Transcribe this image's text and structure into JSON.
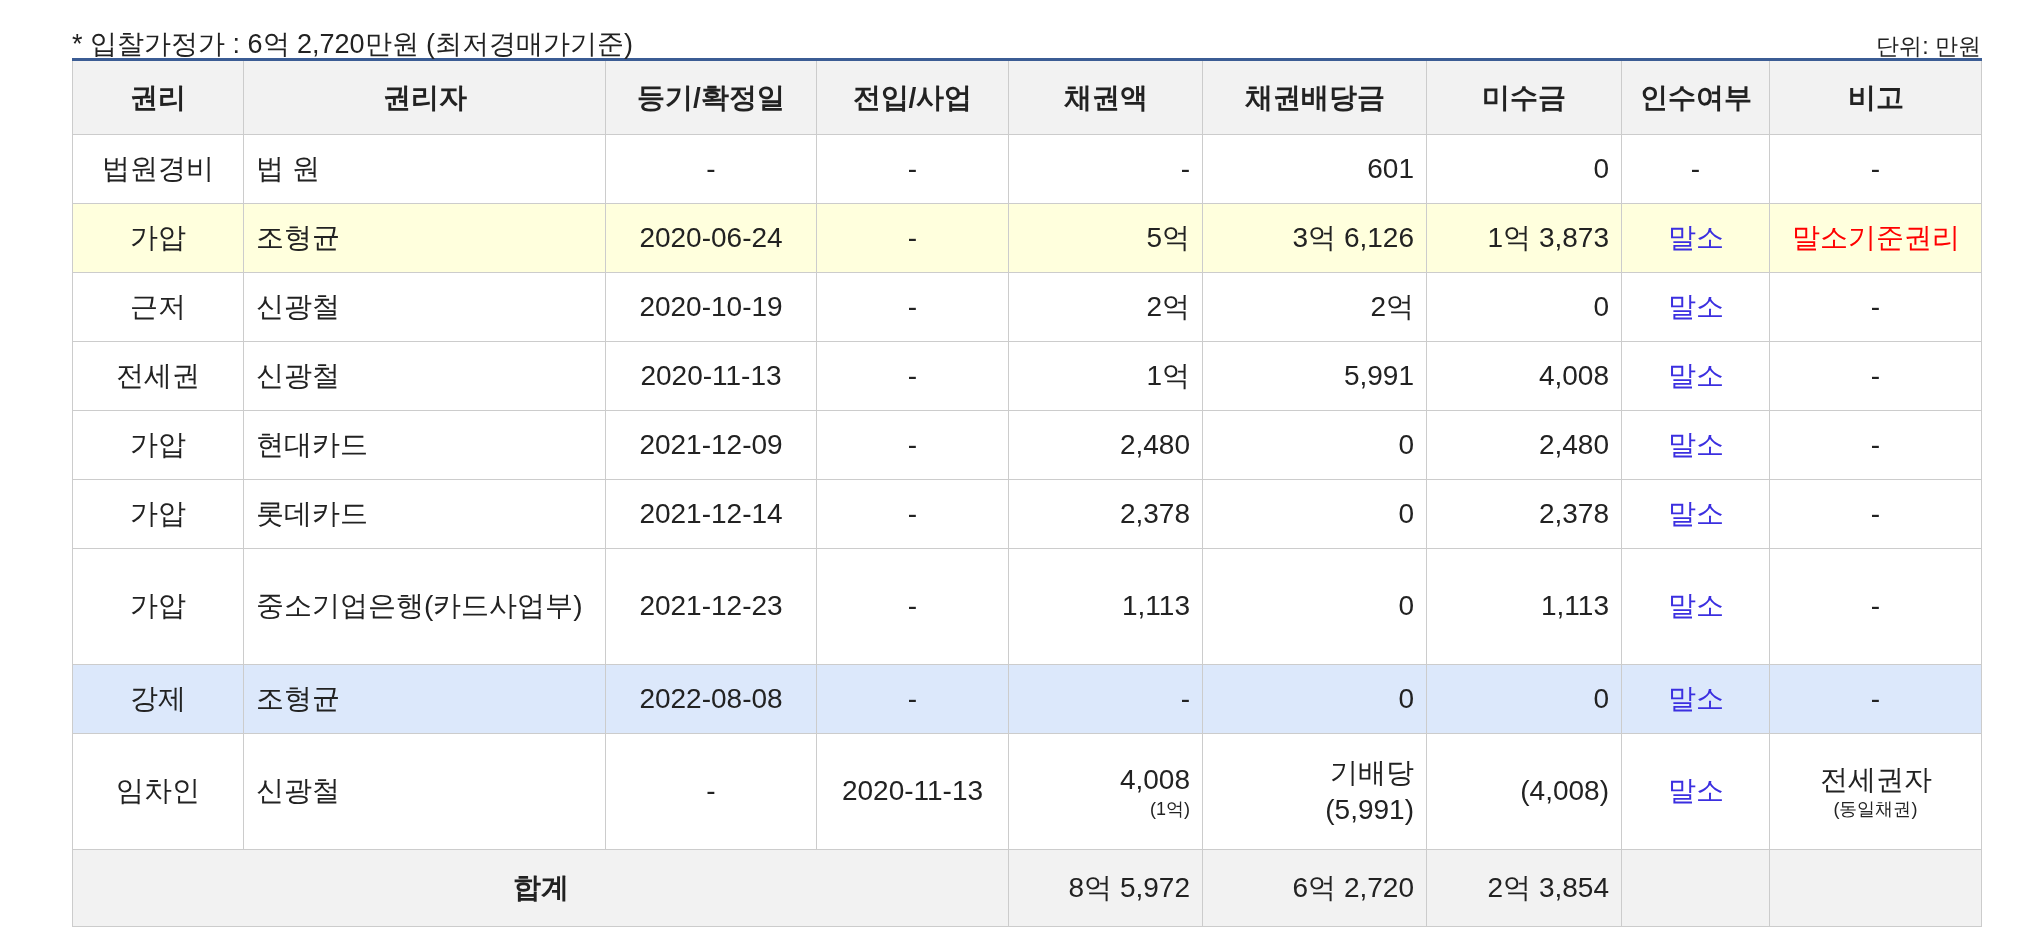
{
  "caption": "* 입찰가정가 : 6억 2,720만원 (최저경매가기준)",
  "unit": "단위: 만원",
  "columns": [
    "권리",
    "권리자",
    "등기/확정일",
    "전입/사업",
    "채권액",
    "채권배당금",
    "미수금",
    "인수여부",
    "비고"
  ],
  "rows": [
    {
      "color": "#ffffff",
      "right": "법원경비",
      "holder": "법 원",
      "date": "-",
      "move_in": "-",
      "claim": "-",
      "dividend": "601",
      "unpaid": "0",
      "assumption": "-",
      "assumption_link": false,
      "remark": "-",
      "remark_alert": false
    },
    {
      "color": "#ffffdd",
      "right": "가압",
      "holder": "조형균",
      "date": "2020-06-24",
      "move_in": "-",
      "claim": "5억",
      "dividend": "3억 6,126",
      "unpaid": "1억 3,873",
      "assumption": "말소",
      "assumption_link": true,
      "remark": "말소기준권리",
      "remark_alert": true
    },
    {
      "color": "#ffffff",
      "right": "근저",
      "holder": "신광철",
      "date": "2020-10-19",
      "move_in": "-",
      "claim": "2억",
      "dividend": "2억",
      "unpaid": "0",
      "assumption": "말소",
      "assumption_link": true,
      "remark": "-",
      "remark_alert": false
    },
    {
      "color": "#ffffff",
      "right": "전세권",
      "holder": "신광철",
      "date": "2020-11-13",
      "move_in": "-",
      "claim": "1억",
      "dividend": "5,991",
      "unpaid": "4,008",
      "assumption": "말소",
      "assumption_link": true,
      "remark": "-",
      "remark_alert": false
    },
    {
      "color": "#ffffff",
      "right": "가압",
      "holder": "현대카드",
      "date": "2021-12-09",
      "move_in": "-",
      "claim": "2,480",
      "dividend": "0",
      "unpaid": "2,480",
      "assumption": "말소",
      "assumption_link": true,
      "remark": "-",
      "remark_alert": false
    },
    {
      "color": "#ffffff",
      "right": "가압",
      "holder": "롯데카드",
      "date": "2021-12-14",
      "move_in": "-",
      "claim": "2,378",
      "dividend": "0",
      "unpaid": "2,378",
      "assumption": "말소",
      "assumption_link": true,
      "remark": "-",
      "remark_alert": false
    },
    {
      "color": "#ffffff",
      "right": "가압",
      "holder": "중소기업은행(카드사업부)",
      "date": "2021-12-23",
      "move_in": "-",
      "claim": "1,113",
      "dividend": "0",
      "unpaid": "1,113",
      "assumption": "말소",
      "assumption_link": true,
      "remark": "-",
      "remark_alert": false
    },
    {
      "color": "#dce8fb",
      "right": "강제",
      "holder": "조형균",
      "date": "2022-08-08",
      "move_in": "-",
      "claim": "-",
      "dividend": "0",
      "unpaid": "0",
      "assumption": "말소",
      "assumption_link": true,
      "remark": "-",
      "remark_alert": false
    },
    {
      "color": "#ffffff",
      "right": "임차인",
      "holder": "신광철",
      "date": "-",
      "move_in": "2020-11-13",
      "claim": "4,008",
      "claim_note": "(1억)",
      "dividend": "기배당",
      "dividend_note": "(5,991)",
      "unpaid": "(4,008)",
      "assumption": "말소",
      "assumption_link": true,
      "remark": "전세권자",
      "remark_note": "(동일채권)",
      "remark_alert": false
    }
  ],
  "total": {
    "label": "합계",
    "claim": "8억 5,972",
    "dividend": "6억 2,720",
    "unpaid": "2억 3,854"
  }
}
